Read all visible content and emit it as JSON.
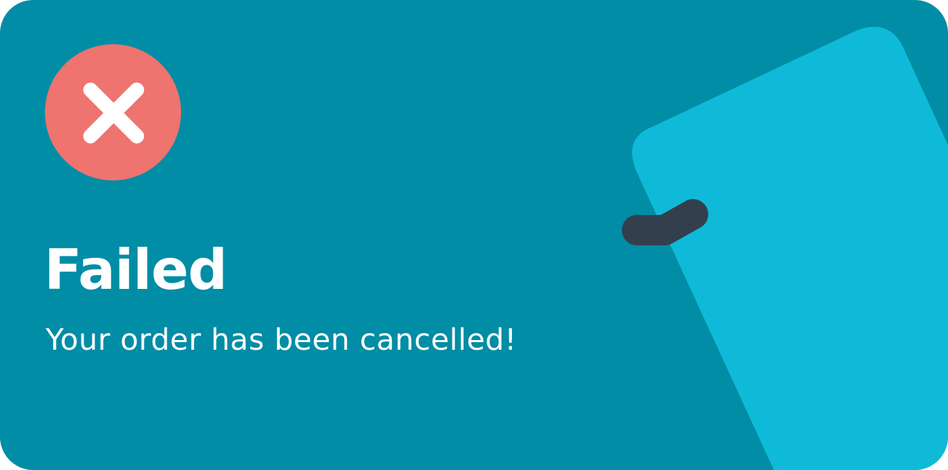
{
  "notification": {
    "status": "failed",
    "title": "Failed",
    "message": "Your order has been cancelled!",
    "icon": "close-icon"
  },
  "colors": {
    "background": "#008da5",
    "icon_circle": "#ef736f",
    "card_illustration": "#0fbad8",
    "handle": "#333f4d",
    "text": "#ffffff"
  }
}
